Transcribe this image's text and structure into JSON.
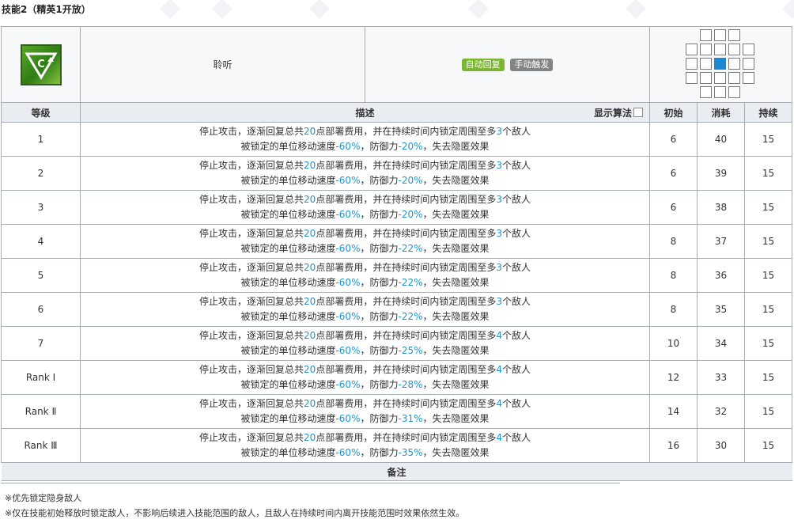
{
  "page_title": "技能2（精英1开放）",
  "skill": {
    "name": "聆听",
    "tags": [
      "自动回复",
      "手动触发"
    ],
    "icon": "green-triangle-skill-icon"
  },
  "columns": {
    "level": "等级",
    "description": "描述",
    "show_formula": "显示算法",
    "initial": "初始",
    "cost": "消耗",
    "duration": "持续"
  },
  "desc_text": {
    "p1": "停止攻击，逐渐回复总共",
    "p2": "点部署费用，并在持续时间内锁定周围至多",
    "p3": "个敌人",
    "p4": "被锁定的单位移动速度",
    "p5": "，防御力",
    "p6": "，失去隐匿效果"
  },
  "levels": [
    {
      "level": "1",
      "dp": "20",
      "targets": "3",
      "speed": "-60%",
      "def": "-20%",
      "initial": "6",
      "cost": "40",
      "duration": "15"
    },
    {
      "level": "2",
      "dp": "20",
      "targets": "3",
      "speed": "-60%",
      "def": "-20%",
      "initial": "6",
      "cost": "39",
      "duration": "15"
    },
    {
      "level": "3",
      "dp": "20",
      "targets": "3",
      "speed": "-60%",
      "def": "-20%",
      "initial": "6",
      "cost": "38",
      "duration": "15"
    },
    {
      "level": "4",
      "dp": "20",
      "targets": "3",
      "speed": "-60%",
      "def": "-22%",
      "initial": "8",
      "cost": "37",
      "duration": "15"
    },
    {
      "level": "5",
      "dp": "20",
      "targets": "3",
      "speed": "-60%",
      "def": "-22%",
      "initial": "8",
      "cost": "36",
      "duration": "15"
    },
    {
      "level": "6",
      "dp": "20",
      "targets": "3",
      "speed": "-60%",
      "def": "-22%",
      "initial": "8",
      "cost": "35",
      "duration": "15"
    },
    {
      "level": "7",
      "dp": "20",
      "targets": "4",
      "speed": "-60%",
      "def": "-25%",
      "initial": "10",
      "cost": "34",
      "duration": "15"
    },
    {
      "level": "Rank Ⅰ",
      "dp": "20",
      "targets": "4",
      "speed": "-60%",
      "def": "-28%",
      "initial": "12",
      "cost": "33",
      "duration": "15"
    },
    {
      "level": "Rank Ⅱ",
      "dp": "20",
      "targets": "4",
      "speed": "-60%",
      "def": "-31%",
      "initial": "14",
      "cost": "32",
      "duration": "15"
    },
    {
      "level": "Rank Ⅲ",
      "dp": "20",
      "targets": "4",
      "speed": "-60%",
      "def": "-35%",
      "initial": "16",
      "cost": "30",
      "duration": "15"
    }
  ],
  "notes": {
    "header": "备注",
    "lines": [
      "※优先锁定隐身敌人",
      "※仅在技能初始释放时锁定敌人，不影响后续进入技能范围的敌人，且敌人在持续时间内离开技能范围时效果依然生效。"
    ]
  },
  "colors": {
    "highlight": "#1e95cc",
    "tag_green": "#7cb532",
    "tag_gray": "#848484",
    "range_center": "#1c87d4"
  }
}
